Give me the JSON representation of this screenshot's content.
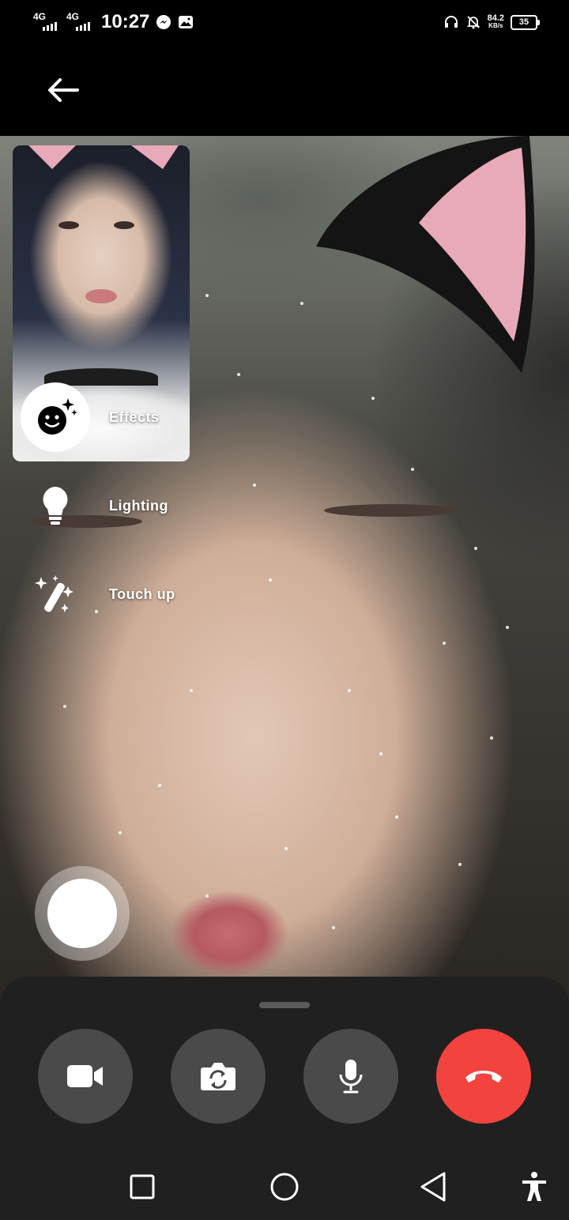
{
  "status_bar": {
    "signal_1_label": "4G",
    "signal_2_label": "4G",
    "time": "10:27",
    "notification_icons": [
      "messenger-icon",
      "gallery-icon"
    ],
    "right_icons": [
      "headphones-icon",
      "mute-bell-icon"
    ],
    "network_speed_value": "84.2",
    "network_speed_unit": "KB/s",
    "battery_level": "35"
  },
  "top_bar": {
    "back_icon": "arrow-left-icon"
  },
  "effects_menu": {
    "items": [
      {
        "id": "effects",
        "label": "Effects",
        "icon": "smiley-sparkle-icon"
      },
      {
        "id": "lighting",
        "label": "Lighting",
        "icon": "lightbulb-icon"
      },
      {
        "id": "touch_up",
        "label": "Touch up",
        "icon": "magic-wand-icon"
      }
    ]
  },
  "call_controls": {
    "buttons": [
      {
        "id": "video",
        "icon": "video-camera-icon"
      },
      {
        "id": "flip_camera",
        "icon": "camera-flip-icon"
      },
      {
        "id": "microphone",
        "icon": "microphone-icon"
      },
      {
        "id": "end_call",
        "icon": "end-call-icon"
      }
    ],
    "end_call_color": "#f3433f"
  },
  "nav_bar": {
    "buttons": [
      "recents-square-icon",
      "home-circle-icon",
      "back-triangle-icon",
      "accessibility-icon"
    ]
  },
  "colors": {
    "controls_background": "#202020",
    "control_button": "#4a4a4a"
  }
}
